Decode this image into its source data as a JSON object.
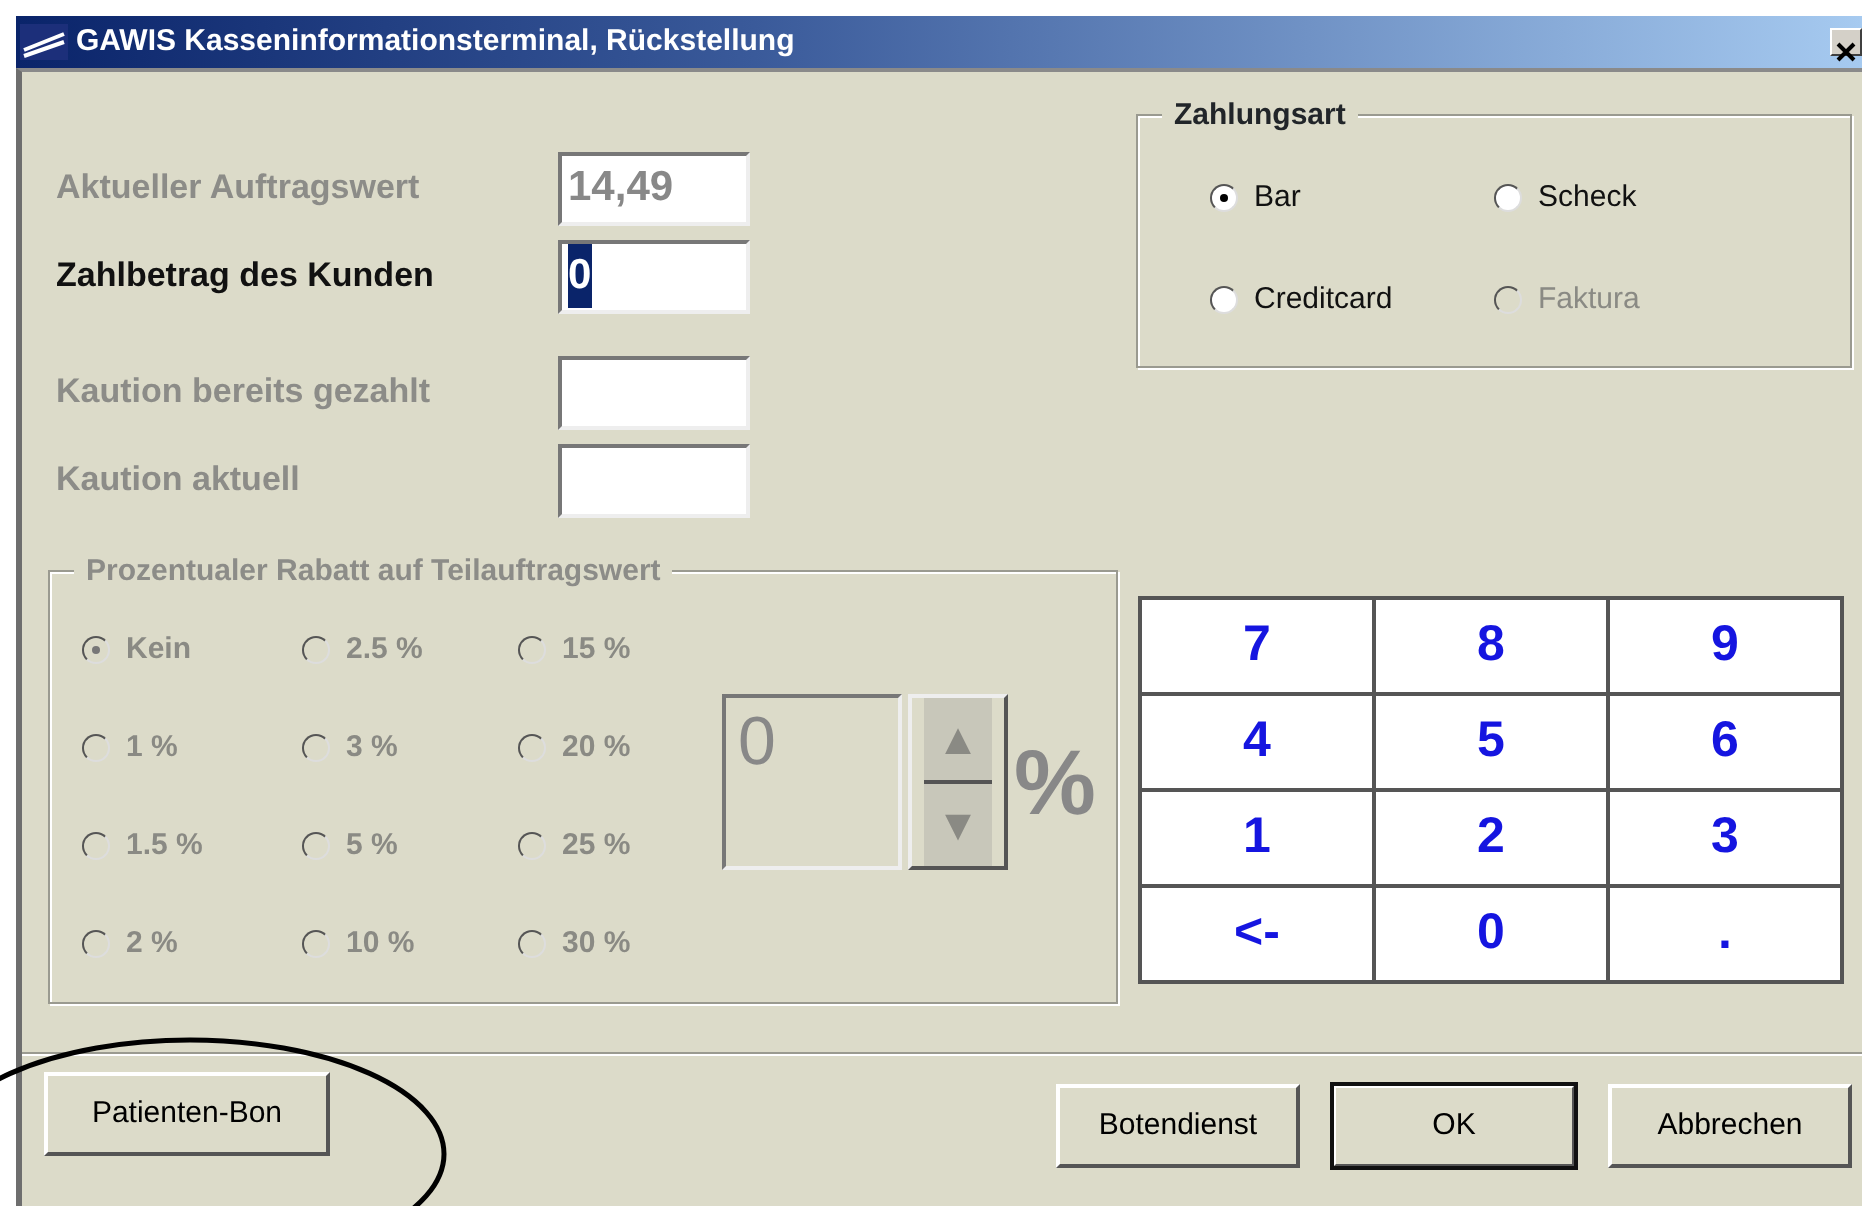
{
  "window": {
    "title": "GAWIS Kasseninformationsterminal, Rückstellung"
  },
  "fields": [
    {
      "label": "Aktueller Auftragswert",
      "value": "14,49",
      "disabled": true,
      "highlighted": false
    },
    {
      "label": "Zahlbetrag des Kunden",
      "value": "0",
      "disabled": false,
      "highlighted": true
    },
    {
      "label": "Kaution bereits gezahlt",
      "disabled": true
    },
    {
      "label": "Kaution aktuell",
      "disabled": true
    }
  ],
  "payment": {
    "title": "Zahlungsart",
    "options": [
      {
        "label": "Bar",
        "selected": true,
        "disabled": false
      },
      {
        "label": "Scheck",
        "selected": false,
        "disabled": false
      },
      {
        "label": "Creditcard",
        "selected": false,
        "disabled": false
      },
      {
        "label": "Faktura",
        "selected": false,
        "disabled": true
      }
    ]
  },
  "discount": {
    "title": "Prozentualer Rabatt auf Teilauftragswert",
    "disabled": true,
    "options": [
      {
        "label": "Kein",
        "selected": true
      },
      {
        "label": "2.5 %",
        "selected": false
      },
      {
        "label": "15 %",
        "selected": false
      },
      {
        "label": "1 %",
        "selected": false
      },
      {
        "label": "3 %",
        "selected": false
      },
      {
        "label": "20 %",
        "selected": false
      },
      {
        "label": "1.5 %",
        "selected": false
      },
      {
        "label": "5 %",
        "selected": false
      },
      {
        "label": "25 %",
        "selected": false
      },
      {
        "label": "2 %",
        "selected": false
      },
      {
        "label": "10 %",
        "selected": false
      },
      {
        "label": "30 %",
        "selected": false
      }
    ],
    "spinner": {
      "value": "0",
      "up": "▲",
      "down": "▼"
    },
    "unit": "%"
  },
  "keypad": {
    "keys": [
      "7",
      "8",
      "9",
      "4",
      "5",
      "6",
      "1",
      "2",
      "3",
      "<-",
      "0",
      "."
    ]
  },
  "buttons": [
    {
      "label": "Patienten-Bon",
      "default": false
    },
    {
      "label": "Botendienst",
      "default": false
    },
    {
      "label": "OK",
      "default": true
    },
    {
      "label": "Abbrechen",
      "default": false
    }
  ],
  "annotation": {
    "kind": "ellipse"
  }
}
